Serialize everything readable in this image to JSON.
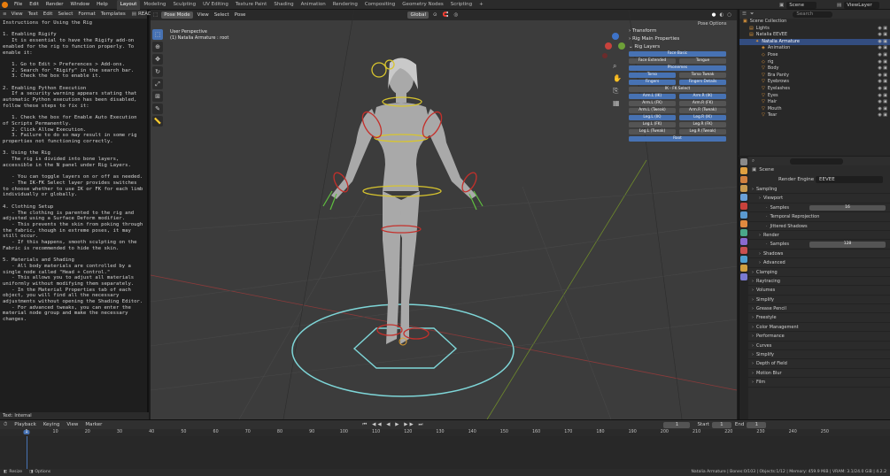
{
  "menu": {
    "items": [
      "File",
      "Edit",
      "Render",
      "Window",
      "Help"
    ],
    "workspaces": [
      "Layout",
      "Modeling",
      "Sculpting",
      "UV Editing",
      "Texture Paint",
      "Shading",
      "Animation",
      "Rendering",
      "Compositing",
      "Geometry Nodes",
      "Scripting"
    ],
    "active_workspace": "Layout",
    "scene_label": "Scene",
    "view_layer_label": "ViewLayer"
  },
  "text_editor": {
    "menu": [
      "View",
      "Text",
      "Edit",
      "Select",
      "Format",
      "Templates"
    ],
    "filename": "README",
    "content": "Instructions for Using the Rig\n\n1. Enabling Rigify\n   It is essential to have the Rigify add-on\nenabled for the rig to function properly. To\nenable it:\n\n   1. Go to Edit > Preferences > Add-ons.\n   2. Search for \"Rigify\" in the search bar.\n   3. Check the box to enable it.\n\n2. Enabling Python Execution\n   If a security warning appears stating that\nautomatic Python execution has been disabled,\nfollow these steps to fix it:\n\n   1. Check the box for Enable Auto Execution\nof Scripts Permanently.\n   2. Click Allow Execution.\n   3. Failure to do so may result in some rig\nproperties not functioning correctly.\n\n3. Using the Rig\n   The rig is divided into bone layers,\naccessible in the N panel under Rig Layers.\n\n   - You can toggle layers on or off as needed.\n   - The IK-FK Select layer provides switches\nto choose whether to use IK or FK for each limb\nindividually or globally.\n\n4. Clothing Setup\n   - The clothing is parented to the rig and\nadjusted using a Surface Deform modifier.\n   - This prevents the skin from poking through\nthe fabric, though in extreme poses, it may\nstill occur.\n   - If this happens, smooth sculpting on the\nFabric is recommended to hide the skin.\n\n5. Materials and Shading\n   - All body materials are controlled by a\nsingle node called \"Head + Control.\"\n   - This allows you to adjust all materials\nuniformly without modifying them separately.\n   - In the Material Properties tab of each\nobject, you will find all the necessary\nadjustments without opening the Shading Editor.\n   - For advanced tweaks, you can enter the\nmaterial node group and make the necessary\nchanges.",
    "footer": "Text: Internal"
  },
  "viewport": {
    "mode": "Pose Mode",
    "menu": [
      "View",
      "Select",
      "Pose"
    ],
    "transform_orientation": "Global",
    "info_line1": "User Perspective",
    "info_line2": "(1) Natalia Armature : root",
    "pose_options": "Pose Options"
  },
  "npanel": {
    "transform": "Transform",
    "rig_main_props": "Rig Main Properties",
    "rig_layers": "Rig Layers",
    "rows": [
      [
        {
          "label": "Face Basic",
          "on": true
        }
      ],
      [
        {
          "label": "Face Extended",
          "on": false
        },
        {
          "label": "Tongue",
          "on": false
        }
      ],
      [
        {
          "label": "Phonemes",
          "on": true
        }
      ],
      [
        {
          "label": "Torso",
          "on": true
        },
        {
          "label": "Torso Tweak",
          "on": false
        }
      ],
      [
        {
          "label": "Fingers",
          "on": true
        },
        {
          "label": "Fingers Details",
          "on": true
        }
      ],
      [
        {
          "label": "IK - FK Select",
          "on": false
        }
      ],
      [
        {
          "label": "Arm.L (IK)",
          "on": true
        },
        {
          "label": "Arm.R (IK)",
          "on": true
        }
      ],
      [
        {
          "label": "Arm.L (FK)",
          "on": false
        },
        {
          "label": "Arm.R (FK)",
          "on": false
        }
      ],
      [
        {
          "label": "Arm.L (Tweak)",
          "on": false
        },
        {
          "label": "Arm.R (Tweak)",
          "on": false
        }
      ],
      [
        {
          "label": "Leg.L (IK)",
          "on": true
        },
        {
          "label": "Leg.R (IK)",
          "on": true
        }
      ],
      [
        {
          "label": "Leg.L (FK)",
          "on": false
        },
        {
          "label": "Leg.R (FK)",
          "on": false
        }
      ],
      [
        {
          "label": "Leg.L (Tweak)",
          "on": false
        },
        {
          "label": "Leg.R (Tweak)",
          "on": false
        }
      ],
      [
        {
          "label": "Root",
          "on": true
        }
      ]
    ],
    "side_tabs": [
      "Item",
      "Tool",
      "View",
      "Animation",
      "Edit",
      "Photographer",
      "Rigify",
      "Gn Data Brush",
      "Create",
      "DAZ Setup",
      "Node Wrangler",
      "Quick Smooth",
      "Animate"
    ]
  },
  "outliner": {
    "search_placeholder": "Search",
    "rows": [
      {
        "label": "Scene Collection",
        "indent": 0,
        "selected": false
      },
      {
        "label": "Lights",
        "indent": 1,
        "selected": false
      },
      {
        "label": "Natalia EEVEE",
        "indent": 1,
        "selected": false
      },
      {
        "label": "Natalia Armature",
        "indent": 2,
        "selected": true
      },
      {
        "label": "Animation",
        "indent": 3,
        "selected": false
      },
      {
        "label": "Pose",
        "indent": 3,
        "selected": false
      },
      {
        "label": "rig",
        "indent": 3,
        "selected": false
      },
      {
        "label": "Body",
        "indent": 3,
        "selected": false
      },
      {
        "label": "Bra Panty",
        "indent": 3,
        "selected": false
      },
      {
        "label": "Eyebrows",
        "indent": 3,
        "selected": false
      },
      {
        "label": "Eyelashes",
        "indent": 3,
        "selected": false
      },
      {
        "label": "Eyes",
        "indent": 3,
        "selected": false
      },
      {
        "label": "Hair",
        "indent": 3,
        "selected": false
      },
      {
        "label": "Mouth",
        "indent": 3,
        "selected": false
      },
      {
        "label": "Tear",
        "indent": 3,
        "selected": false
      }
    ]
  },
  "properties": {
    "scene_label": "Scene",
    "render_engine_label": "Render Engine",
    "render_engine_value": "EEVEE",
    "rows": [
      {
        "label": "Sampling",
        "indent": 0,
        "value": ""
      },
      {
        "label": "Viewport",
        "indent": 1,
        "value": ""
      },
      {
        "label": "Samples",
        "indent": 2,
        "value": "16"
      },
      {
        "label": "Temporal Reprojection",
        "indent": 2,
        "value": ""
      },
      {
        "label": "Jittered Shadows",
        "indent": 2,
        "value": ""
      },
      {
        "label": "Render",
        "indent": 1,
        "value": ""
      },
      {
        "label": "Samples",
        "indent": 2,
        "value": "128"
      },
      {
        "label": "Shadows",
        "indent": 1,
        "value": ""
      },
      {
        "label": "Advanced",
        "indent": 1,
        "value": ""
      },
      {
        "label": "Clamping",
        "indent": 0,
        "value": ""
      },
      {
        "label": "Raytracing",
        "indent": 0,
        "value": ""
      },
      {
        "label": "Volumes",
        "indent": 0,
        "value": ""
      },
      {
        "label": "Simplify",
        "indent": 0,
        "value": ""
      },
      {
        "label": "Grease Pencil",
        "indent": 0,
        "value": ""
      },
      {
        "label": "Freestyle",
        "indent": 0,
        "value": ""
      },
      {
        "label": "Color Management",
        "indent": 0,
        "value": ""
      },
      {
        "label": "Performance",
        "indent": 0,
        "value": ""
      },
      {
        "label": "Curves",
        "indent": 0,
        "value": ""
      },
      {
        "label": "Simplify",
        "indent": 0,
        "value": ""
      },
      {
        "label": "Depth of Field",
        "indent": 0,
        "value": ""
      },
      {
        "label": "Motion Blur",
        "indent": 0,
        "value": ""
      },
      {
        "label": "Film",
        "indent": 0,
        "value": ""
      }
    ]
  },
  "timeline": {
    "menu": [
      "Playback",
      "Keying",
      "View",
      "Marker"
    ],
    "current_frame": "1",
    "start_label": "Start",
    "start": "1",
    "end_label": "End",
    "end": "1",
    "ticks": [
      "1",
      "10",
      "20",
      "30",
      "40",
      "50",
      "60",
      "70",
      "80",
      "90",
      "100",
      "110",
      "120",
      "130",
      "140",
      "150",
      "160",
      "170",
      "180",
      "190",
      "200",
      "210",
      "220",
      "230",
      "240",
      "250"
    ]
  },
  "status": {
    "left1": "Resize",
    "left2": "Options",
    "right": "Natalia Armature | Bones:0/103 | Objects:1/12 | Memory: 459.9 MiB | VRAM: 3.1/24.0 GiB | 4.2.2"
  }
}
